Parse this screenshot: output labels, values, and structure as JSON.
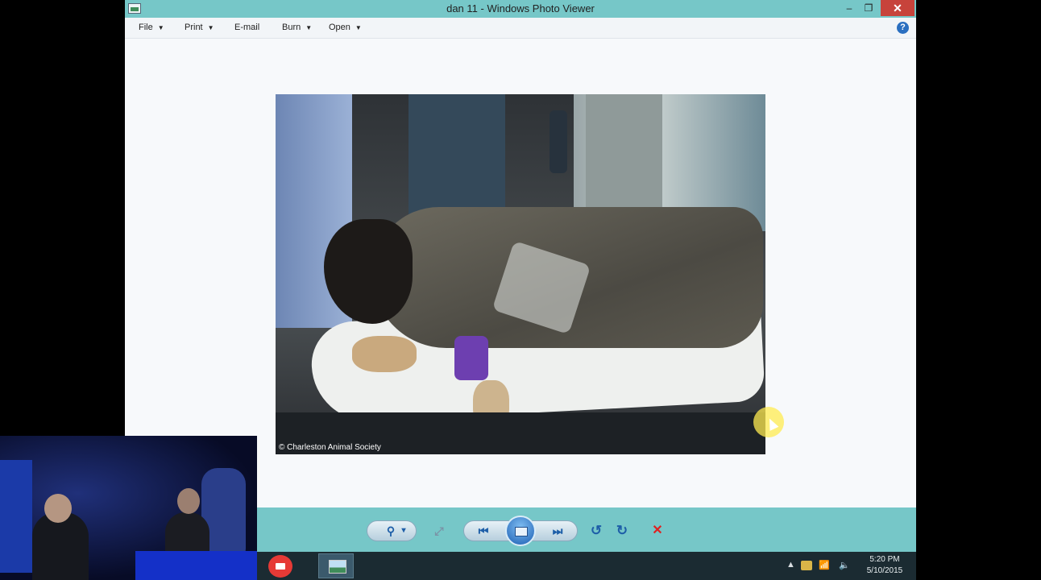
{
  "window": {
    "title": "dan 11 - Windows Photo Viewer",
    "controls": {
      "minimize": "–",
      "maximize": "❐",
      "close": "✕"
    }
  },
  "menu": {
    "items": [
      {
        "label": "File",
        "has_dropdown": true
      },
      {
        "label": "Print",
        "has_dropdown": true
      },
      {
        "label": "E-mail",
        "has_dropdown": false
      },
      {
        "label": "Burn",
        "has_dropdown": true
      },
      {
        "label": "Open",
        "has_dropdown": true
      }
    ],
    "dropdown_glyph": "▼",
    "help_glyph": "?"
  },
  "photo": {
    "caption": "© Charleston Animal Society"
  },
  "controls": {
    "zoom_glyph": "⚲",
    "zoom_arrow": "▾",
    "fit_glyph": "⤢",
    "previous_glyph": "⏮",
    "next_glyph": "⏭",
    "rotate_ccw_glyph": "↺",
    "rotate_cw_glyph": "↻",
    "delete_glyph": "✕"
  },
  "taskbar": {
    "tray": {
      "show_hidden": "▲",
      "network": "📶",
      "volume": "🔈"
    },
    "time": "5:20 PM",
    "date": "5/10/2015"
  },
  "colors": {
    "window_chrome": "#76c7c8",
    "close_button": "#c7433b",
    "viewer_background": "#f7f9fb",
    "delete_red": "#e02020",
    "taskbar": "#1b2b32"
  }
}
